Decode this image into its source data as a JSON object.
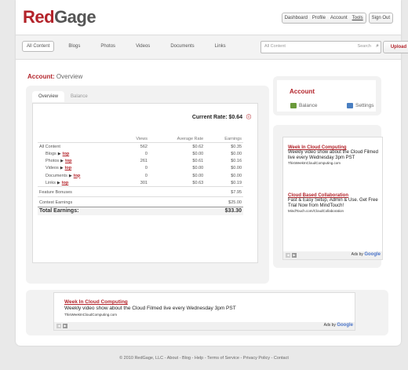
{
  "brand": {
    "part1": "Red",
    "part2": "Gage",
    "accent": "#b3232a"
  },
  "usernav": {
    "dashboard": "Dashboard",
    "profile": "Profile",
    "account": "Account",
    "tools": "Tools",
    "signout": "Sign Out"
  },
  "nav": {
    "items": [
      "All Content",
      "Blogs",
      "Photos",
      "Videos",
      "Documents",
      "Links"
    ]
  },
  "search": {
    "placeholder": "All Content",
    "label": "Search",
    "icon": "magnifier-icon"
  },
  "upload": "Upload",
  "account_header": {
    "label": "Account:",
    "page": "Overview"
  },
  "tabs": [
    "Overview",
    "Balance"
  ],
  "current_rate": {
    "label": "Current Rate:",
    "value": "$0.64"
  },
  "table": {
    "headers": [
      "",
      "Views",
      "Average Rate",
      "Earnings"
    ],
    "all_content": {
      "label": "All Content",
      "views": "562",
      "rate": "$0.62",
      "earnings": "$0.35"
    },
    "rows": [
      {
        "label": "Blogs",
        "link": "top",
        "views": "0",
        "rate": "$0.00",
        "earnings": "$0.00"
      },
      {
        "label": "Photos",
        "link": "top",
        "views": "261",
        "rate": "$0.61",
        "earnings": "$0.16"
      },
      {
        "label": "Videos",
        "link": "top",
        "views": "0",
        "rate": "$0.00",
        "earnings": "$0.00"
      },
      {
        "label": "Documents",
        "link": "top",
        "views": "0",
        "rate": "$0.00",
        "earnings": "$0.00"
      },
      {
        "label": "Links",
        "link": "top",
        "views": "301",
        "rate": "$0.63",
        "earnings": "$0.19"
      }
    ],
    "feature_bonuses": {
      "label": "Feature Bonuses",
      "value": "$7.95"
    },
    "contest_earnings": {
      "label": "Contest Earnings",
      "value": "$25.00"
    },
    "total": {
      "label": "Total Earnings:",
      "value": "$33.30"
    }
  },
  "account_box": {
    "title": "Account",
    "balance": "Balance",
    "settings": "Settings"
  },
  "ads": [
    {
      "title": "Week In Cloud Computing",
      "desc": "Weekly video show about the Cloud Filmed live every Wednesday 3pm PST",
      "url": "ThisWeekInCloudComputing.com"
    },
    {
      "title": "Cloud Based Collaboration",
      "desc": "Fast & Easy Setup, Admin & Use. Get Free Trial Now from MindTouch!",
      "url": "MindTouch.com/CloudCollaboration"
    }
  ],
  "ads_by": {
    "prefix": "Ads by",
    "brand": "Google"
  },
  "bottom_ad": {
    "title": "Week In Cloud Computing",
    "desc": "Weekly video show about the Cloud Filmed live every Wednesday 3pm PST",
    "url": "ThisWeekInCloudComputing.com"
  },
  "footer": "© 2010 RedGage, LLC - About - Blog - Help - Terms of Service - Privacy Policy - Contact"
}
